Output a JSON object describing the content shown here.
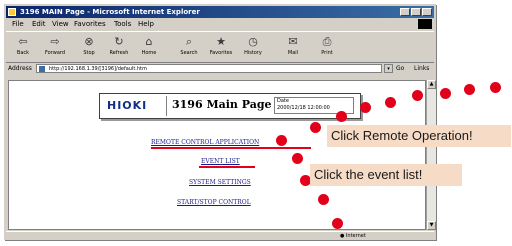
{
  "window": {
    "title": "3196 MAIN Page - Microsoft Internet Explorer"
  },
  "menubar": {
    "items": [
      "File",
      "Edit",
      "View",
      "Favorites",
      "Tools",
      "Help"
    ]
  },
  "toolbar": {
    "buttons": [
      "Back",
      "Forward",
      "Stop",
      "Refresh",
      "Home",
      "Search",
      "Favorites",
      "History",
      "Mail",
      "Print"
    ]
  },
  "address_bar": {
    "label": "Address",
    "url": "http://192.168.1.39/[3196]/default.htm",
    "go_label": "Go",
    "links_label": "Links"
  },
  "page": {
    "logo_text": "HIOKI",
    "title": "3196 Main Page",
    "date_label": "Date",
    "date_value": "2000/12/18  12:00:00",
    "links": [
      "REMOTE CONTROL APPLICATION",
      "EVENT LIST",
      "SYSTEM SETTINGS",
      "START/STOP CONTROL"
    ]
  },
  "statusbar": {
    "zone": "Internet"
  },
  "callouts": {
    "remote": "Click Remote Operation!",
    "event": "Click the event list!"
  },
  "colors": {
    "accent_red": "#e3001b",
    "callout_bg": "#f6dcc7",
    "hioki_blue": "#0f2f8a"
  }
}
